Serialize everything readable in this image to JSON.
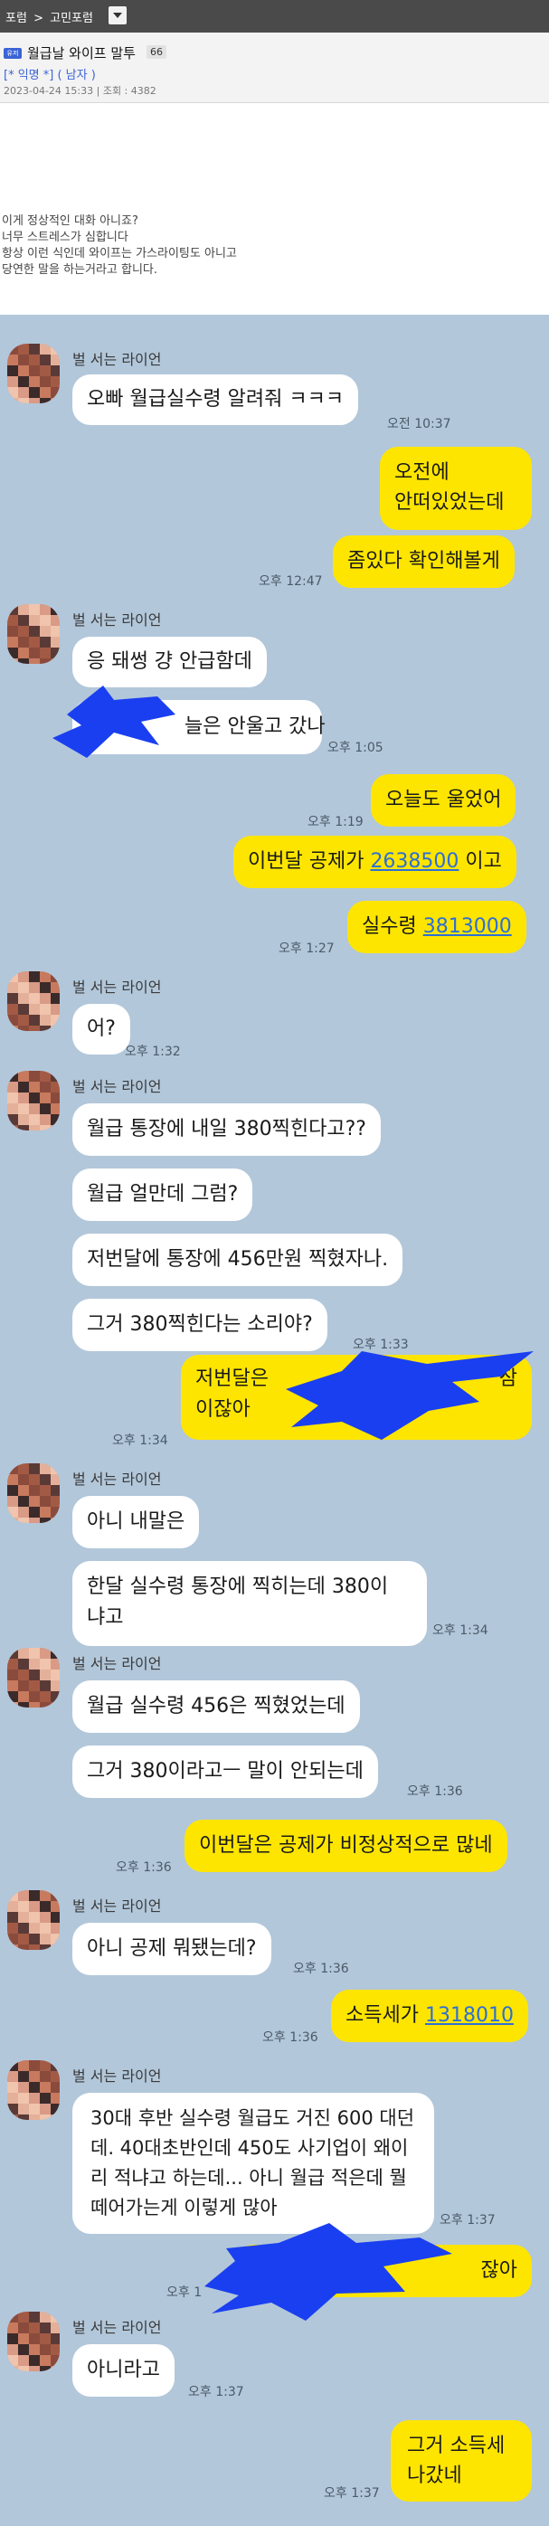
{
  "breadcrumb": {
    "board": "포럼",
    "separator": ">",
    "sub": "고민포럼"
  },
  "post": {
    "tag": "유저",
    "title": "월급날 와이프 말투",
    "comment_count": "66",
    "author": "[* 익명 *] ( 남자 )",
    "meta": "2023-04-24 15:33 | 조회 : 4382",
    "body": [
      "이게 정상적인 대화 아니죠?",
      "너무 스트레스가 심합니다",
      "항상 이런 식인데 와이프는 가스라이팅도 아니고",
      "당연한 말을 하는거라고 합니다."
    ]
  },
  "chat": {
    "sender_name": "벌 서는 라이언",
    "msg": {
      "m1": "오빠 월급실수령 알려줘 ㅋㅋㅋ",
      "t1": "오전 10:37",
      "m2": "오전에\n안떠있었는데",
      "m3": "좀있다 확인해볼게",
      "t2": "오후 12:47",
      "m4": "응 돼썽 걍 안급함데",
      "m5": "늘은 안울고 갔나",
      "t3": "오후 1:05",
      "m6": "오늘도 울었어",
      "t4": "오후 1:19",
      "m7_pre": "이번달 공제가 ",
      "m7_num": "2638500",
      "m7_post": " 이고",
      "m8_pre": "실수령 ",
      "m8_num": "3813000",
      "t5": "오후 1:27",
      "m9": "어?",
      "t6": "오후 1:32",
      "m10": "월급 통장에 내일 380찍힌다고??",
      "m11": "월급 얼만데 그럼?",
      "m12": "저번달에 통장에 456만원 찍혔자나.",
      "m13": "그거 380찍힌다는 소리야?",
      "t7": "오후 1:33",
      "m14a": "저번달은",
      "m14b": "이잖아",
      "m14c": "잠",
      "t8": "오후 1:34",
      "m15": "아니 내말은",
      "m16": "한달 실수령 통장에 찍히는데 380이\n냐고",
      "t9": "오후 1:34",
      "m17": "월급 실수령 456은 찍혔었는데",
      "m18": "그거 380이라고ㅡ 말이 안되는데",
      "t10": "오후 1:36",
      "m19": "이번달은 공제가 비정상적으로 많네",
      "t11": "오후 1:36",
      "m20": "아니 공제 뭐됐는데?",
      "t12": "오후 1:36",
      "m21_pre": "소득세가 ",
      "m21_num": "1318010",
      "t13": "오후 1:36",
      "m22": "30대 후반 실수령 월급도 거진 600 대던데. 40대초반인데 450도 사기업이 왜이리 적냐고 하는데... 아니 월급 적은데 뭘 떼어가는게 이렇게 많아",
      "t14": "오후 1:37",
      "m23": "잖아",
      "t15": "오후 1",
      "m24": "아니라고",
      "t16": "오후 1:37",
      "m25": "그거 소득세\n나갔네",
      "t17": "오후 1:37"
    }
  },
  "colors": {
    "chat_bg": "#b2c7da",
    "bubble_out": "#fee500",
    "bubble_in": "#ffffff",
    "scribble": "#1a3ff0",
    "link": "#2d6fd6"
  }
}
